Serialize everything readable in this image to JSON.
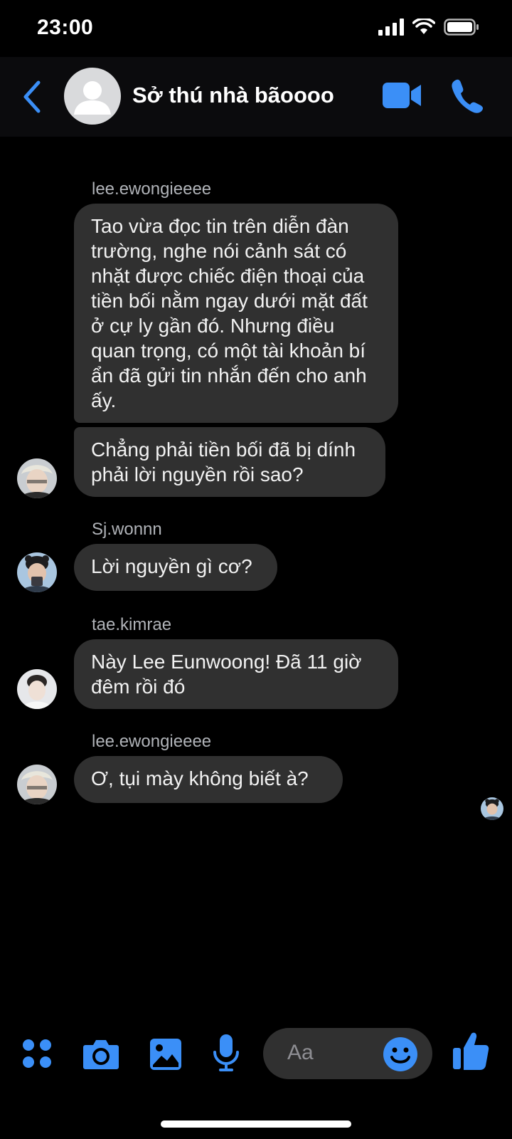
{
  "status_bar": {
    "time": "23:00"
  },
  "header": {
    "title": "Sở thú nhà bãoooo"
  },
  "messages": [
    {
      "sender": "lee.ewongieeee",
      "text": "Tao vừa đọc tin trên diễn đàn trường, nghe nói cảnh sát có nhặt được chiếc điện thoại của tiền bối nằm ngay dưới mặt đất ở cự ly gần đó. Nhưng điều quan trọng, có một tài khoản bí ẩn đã gửi tin nhắn đến cho anh ấy."
    },
    {
      "text": "Chẳng phải tiền bối đã bị dính phải lời nguyền rồi sao?"
    },
    {
      "sender": "Sj.wonnn",
      "text": "Lời nguyền gì cơ?"
    },
    {
      "sender": "tae.kimrae",
      "text": "Này Lee Eunwoong! Đã 11 giờ đêm rồi đó"
    },
    {
      "sender": "lee.ewongieeee",
      "text": "Ơ, tụi mày không biết à?"
    }
  ],
  "composer": {
    "placeholder": "Aa"
  },
  "colors": {
    "accent": "#3b8ff7",
    "bubble": "#303030",
    "background": "#000000"
  },
  "icons": [
    "back-chevron-icon",
    "video-camera-icon",
    "phone-icon",
    "apps-grid-icon",
    "camera-icon",
    "image-icon",
    "microphone-icon",
    "emoji-icon",
    "thumbs-up-icon"
  ]
}
